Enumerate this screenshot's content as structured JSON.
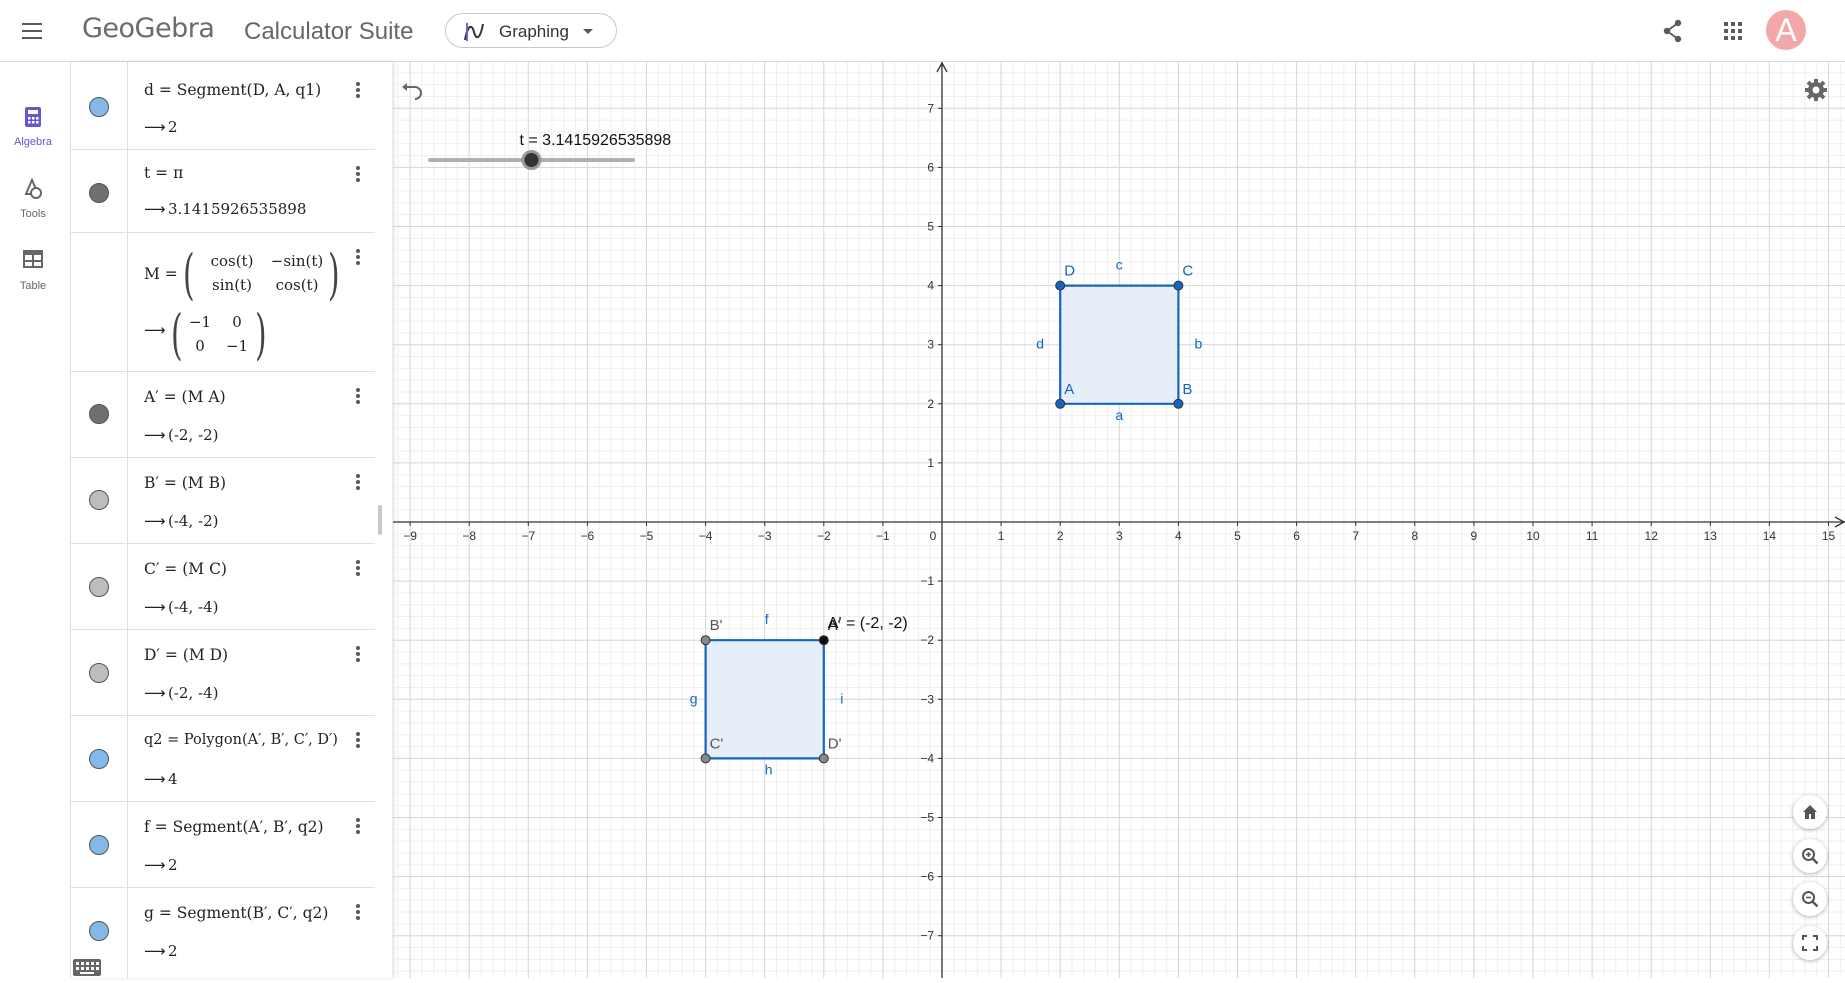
{
  "header": {
    "logo": "GeoGebra",
    "suite_title": "Calculator Suite",
    "app_selector": {
      "selected": "Graphing",
      "icon": "graphing-icon"
    },
    "icons": [
      "menu-icon",
      "share-icon",
      "apps-grid-icon"
    ],
    "avatar_letter": "A",
    "avatar_color": "#f2a8a8"
  },
  "sidebar": {
    "items": [
      {
        "label": "Algebra",
        "icon": "calculator-icon",
        "active": true
      },
      {
        "label": "Tools",
        "icon": "tools-icon",
        "active": false
      },
      {
        "label": "Table",
        "icon": "table-icon",
        "active": false
      }
    ]
  },
  "algebra_view": {
    "rows": [
      {
        "definition": "d = Segment(D, A, q1)",
        "output": "2",
        "dot_color": "#84b8e8"
      },
      {
        "definition": "t = π",
        "output": "3.1415926535898",
        "dot_color": "#707070"
      },
      {
        "definition_lhs": "M =",
        "matrix_def": [
          [
            "cos(t)",
            "−sin(t)"
          ],
          [
            "sin(t)",
            "cos(t)"
          ]
        ],
        "matrix_out": [
          [
            "−1",
            "0"
          ],
          [
            "0",
            "−1"
          ]
        ]
      },
      {
        "definition": "A′ = (M A)",
        "output": "(-2, -2)",
        "dot_color": "#707070"
      },
      {
        "definition": "B′ = (M B)",
        "output": "(-4, -2)",
        "dot_color": "#bdbdbd"
      },
      {
        "definition": "C′ = (M C)",
        "output": "(-4, -4)",
        "dot_color": "#bdbdbd"
      },
      {
        "definition": "D′ = (M D)",
        "output": "(-2, -4)",
        "dot_color": "#bdbdbd"
      },
      {
        "definition": "q2 = Polygon(A′, B′, C′, D′)",
        "output": "4",
        "dot_color": "#84b8e8"
      },
      {
        "definition": "f = Segment(A′, B′, q2)",
        "output": "2",
        "dot_color": "#84b8e8"
      },
      {
        "definition": "g = Segment(B′, C′, q2)",
        "output": "2",
        "dot_color": "#84b8e8"
      }
    ]
  },
  "graphics": {
    "slider": {
      "name": "t",
      "label": "t = 3.1415926535898",
      "min": 0,
      "max": 6.2831853,
      "value": 3.1415926535898
    },
    "axis": {
      "x_ticks": [
        "−9",
        "−8",
        "−7",
        "−6",
        "−5",
        "−4",
        "−3",
        "−2",
        "−1",
        "0",
        "1",
        "2",
        "3",
        "4",
        "5",
        "6",
        "7",
        "8",
        "9",
        "10",
        "11",
        "12",
        "13",
        "14",
        "15"
      ],
      "y_ticks": [
        "−7",
        "−6",
        "−5",
        "−4",
        "−3",
        "−2",
        "−1",
        "1",
        "2",
        "3",
        "4",
        "5",
        "6",
        "7"
      ]
    },
    "polygon_original": {
      "vertices": [
        {
          "label": "A",
          "x": 2,
          "y": 2
        },
        {
          "label": "B",
          "x": 4,
          "y": 2
        },
        {
          "label": "C",
          "x": 4,
          "y": 4
        },
        {
          "label": "D",
          "x": 2,
          "y": 4
        }
      ],
      "edge_labels": [
        "a",
        "b",
        "c",
        "d"
      ]
    },
    "polygon_image": {
      "vertices": [
        {
          "label": "A'",
          "x": -2,
          "y": -2
        },
        {
          "label": "B'",
          "x": -4,
          "y": -2
        },
        {
          "label": "C'",
          "x": -4,
          "y": -4
        },
        {
          "label": "D'",
          "x": -2,
          "y": -4
        }
      ],
      "edge_labels": [
        "f",
        "g",
        "h",
        "i"
      ],
      "point_caption": "A' = (-2, -2)"
    },
    "colors": {
      "polygon_stroke": "#1565c0",
      "polygon_fill": "#e3ecf8",
      "label": "#1565c0",
      "image_label": "#555555",
      "grid_major": "#d6d6d6",
      "grid_minor": "#efefef"
    },
    "controls": [
      "undo-icon",
      "settings-icon",
      "home-icon",
      "zoom-in-icon",
      "zoom-out-icon",
      "fullscreen-icon"
    ]
  }
}
